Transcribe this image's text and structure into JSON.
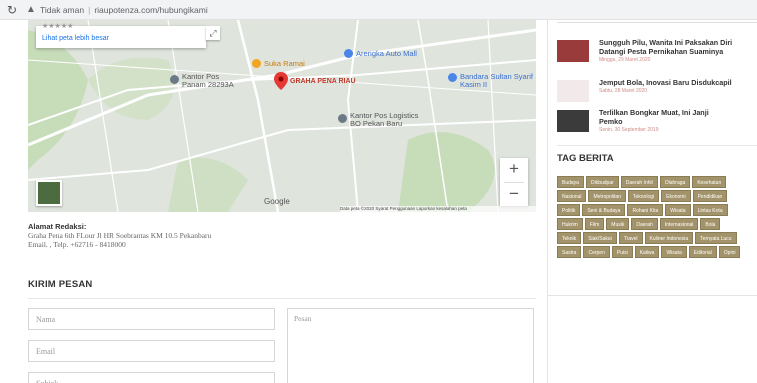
{
  "browser": {
    "security_warning": "Tidak aman",
    "domain": "riaupotenza.com",
    "path": "/hubungikami"
  },
  "map": {
    "rating_stars": "★★★★★",
    "enlarge_link": "Lihat peta lebih besar",
    "zoom_in": "+",
    "zoom_out": "−",
    "google_logo": "Google",
    "footer": "Data peta ©2020 Syarat Penggunaan Laporkan kesalahan peta",
    "places": {
      "suka_ramai": "Suka Ramai",
      "arengka": "Arengka Auto Mall",
      "kantor_pos_panam": "Kantor Pos Panam 28293A",
      "graha_pena": "GRAHA PENA RIAU",
      "bandara": "Bandara Sultan Syarif Kasim II",
      "kantor_pos_logistik": "Kantor Pos Logistics BO Pekan Baru"
    }
  },
  "address": {
    "title": "Alamat Redaksi:",
    "line1": "Graha Pena 6th FLour Jl HR Soebrantas KM 10.5 Pekanbaru",
    "line2": "Email. , Telp. +62716 - 8418000"
  },
  "contact": {
    "heading": "KIRIM PESAN",
    "name_placeholder": "Nama",
    "email_placeholder": "Email",
    "subject_placeholder": "Subjek",
    "message_placeholder": "Pesan"
  },
  "sidebar": {
    "news": [
      {
        "title": "Sungguh Pilu, Wanita Ini Paksakan Diri Datangi Pesta Pernikahan Suaminya",
        "date": "Minggu, 29 Maret 2020"
      },
      {
        "title": "Jemput Bola, Inovasi Baru Disdukcapil",
        "date": "Sabtu, 28 Maret 2020"
      },
      {
        "title": "Terlilkan Bongkar Muat, Ini Janji Pemko",
        "date": "Senin, 30 September 2019"
      }
    ],
    "tag_heading": "TAG BERITA",
    "tags": [
      "Budaya",
      "Dikbudpar",
      "Daerah Inhil",
      "Olahraga",
      "Kesehatan",
      "Nasional",
      "Metropolitan",
      "Teknologi",
      "Ekonomi",
      "Pendidikan",
      "Politik",
      "Seni & Budaya",
      "Rohani Kita",
      "Wisata",
      "Lintas Kota",
      "Hukrim",
      "Film",
      "Musik",
      "Daerah",
      "Internasional",
      "Bola",
      "Teknik",
      "Siak/Sakai",
      "Travel",
      "Kuliner Indonesia",
      "Ternyata Lucu",
      "Sastra",
      "Cerpen",
      "Puisi",
      "Kaliwa",
      "Wisata",
      "Editorial",
      "Opini"
    ],
    "colors": {
      "tag_bg": "#a3936a",
      "date": "#d18c85"
    }
  }
}
